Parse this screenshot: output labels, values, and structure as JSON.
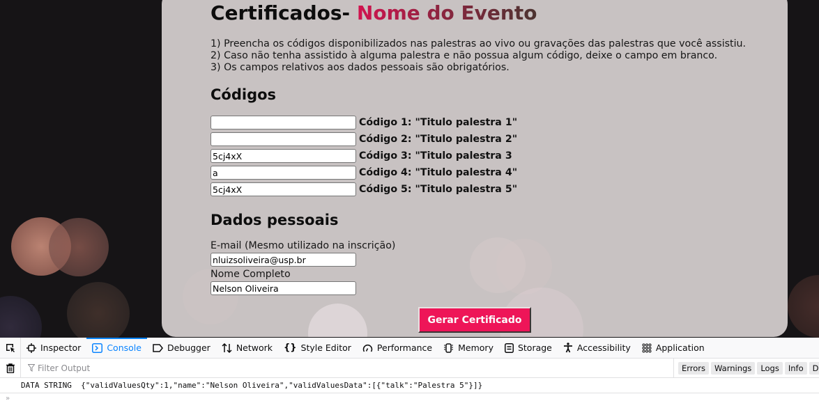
{
  "page": {
    "title_prefix": "Certificados-",
    "title_event": "Nome do Evento",
    "instructions": [
      "1) Preencha os códigos disponibilizados nas palestras ao vivo ou gravações das palestras que você assistiu.",
      "2) Caso não tenha assistido à alguma palestra e não possua algum código, deixe o campo em branco.",
      "3) Os campos relativos aos dados pessoais são obrigatórios."
    ],
    "codes_section_title": "Códigos",
    "codes": [
      {
        "value": "",
        "label": "Código 1: \"Titulo palestra 1\""
      },
      {
        "value": "",
        "label": "Código 2: \"Titulo palestra 2\""
      },
      {
        "value": "5cj4xX",
        "label": "Código 3: \"Titulo palestra 3"
      },
      {
        "value": "a",
        "label": "Código 4: \"Titulo palestra 4\""
      },
      {
        "value": "5cj4xX",
        "label": "Código 5: \"Titulo palestra 5\""
      }
    ],
    "personal_section_title": "Dados pessoais",
    "email": {
      "label": "E-mail (Mesmo utilizado na inscrição)",
      "value": "nluizsoliveira@usp.br"
    },
    "name": {
      "label": "Nome Completo",
      "value": "Nelson Oliveira"
    },
    "submit_label": "Gerar Certificado",
    "colors": {
      "accent": "#ee1558",
      "card": "#c8c2c2",
      "title_gradient_start": "#d2134f",
      "title_gradient_end": "#4c3330"
    }
  },
  "devtools": {
    "tabs": [
      {
        "label": "Inspector",
        "icon": "inspector-icon"
      },
      {
        "label": "Console",
        "icon": "console-icon",
        "active": true
      },
      {
        "label": "Debugger",
        "icon": "debugger-icon"
      },
      {
        "label": "Network",
        "icon": "network-icon"
      },
      {
        "label": "Style Editor",
        "icon": "style-editor-icon"
      },
      {
        "label": "Performance",
        "icon": "performance-icon"
      },
      {
        "label": "Memory",
        "icon": "memory-icon"
      },
      {
        "label": "Storage",
        "icon": "storage-icon"
      },
      {
        "label": "Accessibility",
        "icon": "accessibility-icon"
      },
      {
        "label": "Application",
        "icon": "application-icon"
      }
    ],
    "filter_placeholder": "Filter Output",
    "levels": [
      "Errors",
      "Warnings",
      "Logs",
      "Info",
      "Deb"
    ],
    "log_message": "DATA STRING  {\"validValuesQty\":1,\"name\":\"Nelson Oliveira\",\"validValuesData\":[{\"talk\":\"Palestra 5\"}]}",
    "prompt": "»"
  }
}
